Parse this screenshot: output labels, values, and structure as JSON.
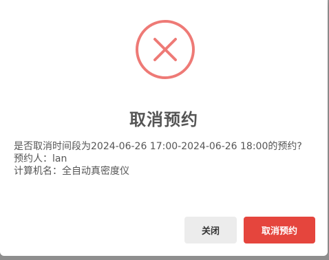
{
  "dialog": {
    "title": "取消预约",
    "message_line": "是否取消时间段为2024-06-26 17:00-2024-06-26 18:00的预约?",
    "reserver_label": "预约人：lan",
    "computer_label": "计算机名：全自动真密度仪",
    "icon": "error-x-circle-icon",
    "accent_color": "#e5453d",
    "icon_color": "#ee7a76"
  },
  "buttons": {
    "close_label": "关闭",
    "confirm_label": "取消预约"
  }
}
